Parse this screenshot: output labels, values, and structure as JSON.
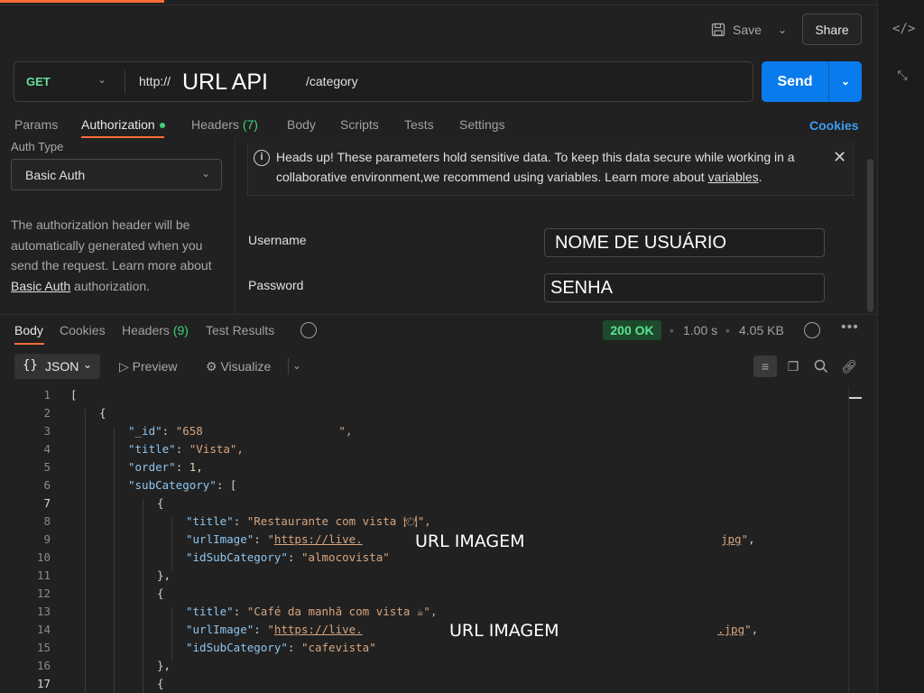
{
  "toolbar": {
    "save_label": "Save",
    "share_label": "Share"
  },
  "request": {
    "method": "GET",
    "url_protocol": "http://",
    "url_redacted": "URL API",
    "url_path": "/category",
    "send_label": "Send"
  },
  "request_tabs": [
    {
      "label": "Params"
    },
    {
      "label": "Authorization"
    },
    {
      "label": "Headers",
      "count": "(7)"
    },
    {
      "label": "Body"
    },
    {
      "label": "Scripts"
    },
    {
      "label": "Tests"
    },
    {
      "label": "Settings"
    }
  ],
  "cookies_label": "Cookies",
  "auth": {
    "type_label": "Auth Type",
    "type_value": "Basic Auth",
    "desc": "The authorization header will be automatically generated when you send the request. Learn more about",
    "desc_link": "Basic Auth",
    "desc_end": "authorization.",
    "notice_text": "Heads up! These parameters hold sensitive data. To keep this data secure while working in a collaborative environment,we recommend using variables. Learn more about",
    "notice_link": "variables",
    "notice_end": ".",
    "username_label": "Username",
    "username_value": "NOME DE USUÁRIO",
    "password_label": "Password",
    "password_value": "SENHA"
  },
  "response_tabs": [
    {
      "label": "Body"
    },
    {
      "label": "Cookies"
    },
    {
      "label": "Headers",
      "count": "(9)"
    },
    {
      "label": "Test Results"
    }
  ],
  "response_meta": {
    "status": "200 OK",
    "time": "1.00 s",
    "size": "4.05 KB"
  },
  "response_toolbar": {
    "format": "JSON",
    "preview": "Preview",
    "visualize": "Visualize"
  },
  "code_overlays": {
    "url_image_1": "URL IMAGEM",
    "url_image_2": "URL IMAGEM"
  },
  "code_lines": [
    {
      "n": "1",
      "text": "["
    },
    {
      "n": "2",
      "text": "{"
    },
    {
      "n": "3",
      "key": "\"_id\"",
      "val": "\"658                    \","
    },
    {
      "n": "4",
      "key": "\"title\"",
      "val": "\"Vista\","
    },
    {
      "n": "5",
      "key": "\"order\"",
      "num": "1,"
    },
    {
      "n": "6",
      "key": "\"subCategory\"",
      "val": "["
    },
    {
      "n": "7",
      "text": "{"
    },
    {
      "n": "8",
      "key": "\"title\"",
      "val": "\"Restaurante com vista 🍽\","
    },
    {
      "n": "9",
      "key": "\"urlImage\"",
      "link": "https://live.",
      "link_end": "jpg"
    },
    {
      "n": "10",
      "key": "\"idSubCategory\"",
      "val": "\"almocovista\""
    },
    {
      "n": "11",
      "text": "},"
    },
    {
      "n": "12",
      "text": "{"
    },
    {
      "n": "13",
      "key": "\"title\"",
      "val": "\"Café da manhã com vista ☕\","
    },
    {
      "n": "14",
      "key": "\"urlImage\"",
      "link": "https://live.",
      "link_end": ".jpg"
    },
    {
      "n": "15",
      "key": "\"idSubCategory\"",
      "val": "\"cafevista\""
    },
    {
      "n": "16",
      "text": "},"
    },
    {
      "n": "17",
      "text": "{"
    }
  ]
}
